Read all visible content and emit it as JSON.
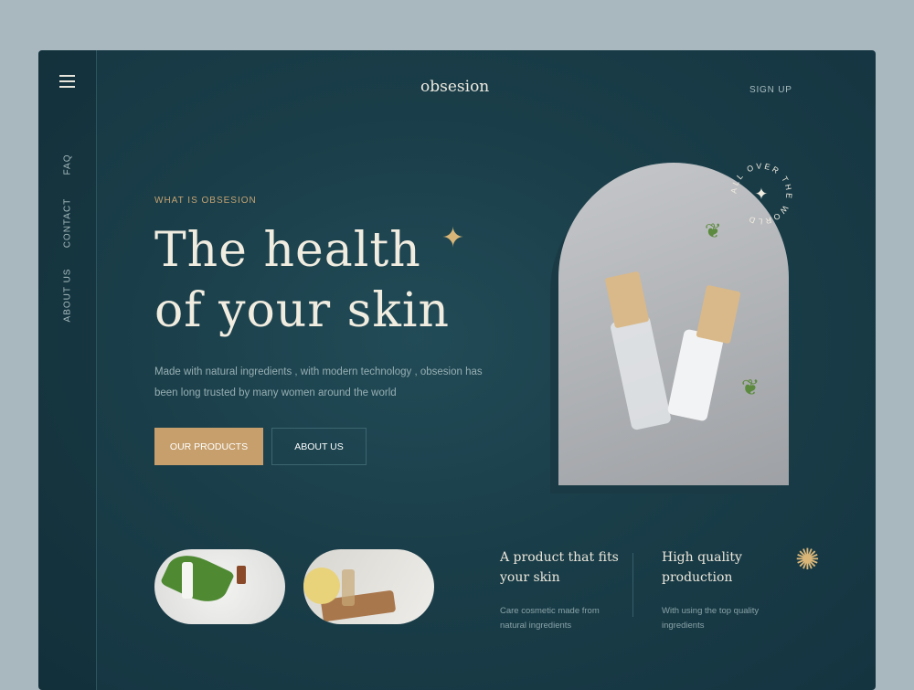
{
  "brand": "obsesion",
  "header": {
    "signup": "SIGN UP"
  },
  "sidebar": {
    "items": [
      "FAQ",
      "CONTACT",
      "ABOUT US"
    ]
  },
  "hero": {
    "eyebrow": "WHAT IS OBSESION",
    "title_line1": "The health",
    "title_line2": "of your skin",
    "description": "Made with natural ingredients , with modern technology , obsesion has been long trusted by many women around the world",
    "primary_button": "OUR PRODUCTS",
    "secondary_button": "ABOUT US",
    "badge_text": "ALL OVER THE WORLD"
  },
  "features": [
    {
      "title": "A product that fits your skin",
      "text": "Care cosmetic made from natural ingredients"
    },
    {
      "title": "High quality production",
      "text": "With using the top quality ingredients"
    }
  ],
  "colors": {
    "accent": "#c69f6c",
    "background": "#1a3e49"
  }
}
